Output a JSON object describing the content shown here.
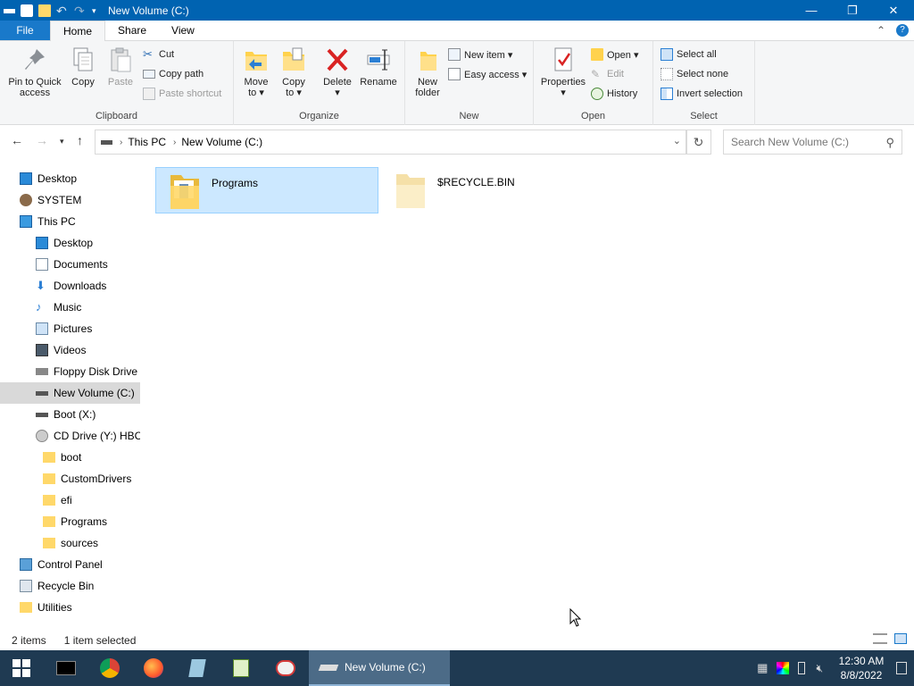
{
  "window": {
    "title": "New Volume (C:)",
    "minimize": "—",
    "maximize": "❐",
    "close": "✕"
  },
  "tabs": [
    "File",
    "Home",
    "Share",
    "View"
  ],
  "ribbon": {
    "clipboard": {
      "label": "Clipboard",
      "pin": "Pin to Quick\naccess",
      "copy": "Copy",
      "paste": "Paste",
      "cut": "Cut",
      "copy_path": "Copy path",
      "paste_shortcut": "Paste shortcut"
    },
    "organize": {
      "label": "Organize",
      "move_to": "Move\nto ▾",
      "copy_to": "Copy\nto ▾",
      "delete": "Delete\n▾",
      "rename": "Rename"
    },
    "new": {
      "label": "New",
      "new_folder": "New\nfolder",
      "new_item": "New item ▾",
      "easy_access": "Easy access ▾"
    },
    "open": {
      "label": "Open",
      "properties": "Properties\n▾",
      "open": "Open ▾",
      "edit": "Edit",
      "history": "History"
    },
    "select": {
      "label": "Select",
      "select_all": "Select all",
      "select_none": "Select none",
      "invert": "Invert selection"
    }
  },
  "address": {
    "segments": [
      "This PC",
      "New Volume (C:)"
    ],
    "search_placeholder": "Search New Volume (C:)"
  },
  "nav_pane": [
    {
      "label": "Desktop",
      "indent": 0,
      "icon": "desktop-icon"
    },
    {
      "label": "SYSTEM",
      "indent": 0,
      "icon": "user-icon"
    },
    {
      "label": "This PC",
      "indent": 0,
      "icon": "pc-icon"
    },
    {
      "label": "Desktop",
      "indent": 1,
      "icon": "desktop-icon"
    },
    {
      "label": "Documents",
      "indent": 1,
      "icon": "documents-icon"
    },
    {
      "label": "Downloads",
      "indent": 1,
      "icon": "downloads-icon"
    },
    {
      "label": "Music",
      "indent": 1,
      "icon": "music-icon"
    },
    {
      "label": "Pictures",
      "indent": 1,
      "icon": "pictures-icon"
    },
    {
      "label": "Videos",
      "indent": 1,
      "icon": "videos-icon"
    },
    {
      "label": "Floppy Disk Drive",
      "indent": 1,
      "icon": "floppy-icon"
    },
    {
      "label": "New Volume (C:)",
      "indent": 1,
      "icon": "drive-icon",
      "selected": true
    },
    {
      "label": "Boot (X:)",
      "indent": 1,
      "icon": "drive-icon"
    },
    {
      "label": "CD Drive (Y:) HBC",
      "indent": 1,
      "icon": "cd-icon"
    },
    {
      "label": "boot",
      "indent": 2,
      "icon": "folder-icon"
    },
    {
      "label": "CustomDrivers",
      "indent": 2,
      "icon": "folder-icon"
    },
    {
      "label": "efi",
      "indent": 2,
      "icon": "folder-icon"
    },
    {
      "label": "Programs",
      "indent": 2,
      "icon": "folder-icon"
    },
    {
      "label": "sources",
      "indent": 2,
      "icon": "folder-icon"
    },
    {
      "label": "Control Panel",
      "indent": 0,
      "icon": "control-panel-icon"
    },
    {
      "label": "Recycle Bin",
      "indent": 0,
      "icon": "recycle-bin-icon"
    },
    {
      "label": "Utilities",
      "indent": 0,
      "icon": "folder-icon"
    }
  ],
  "files": [
    {
      "name": "Programs",
      "selected": true
    },
    {
      "name": "$RECYCLE.BIN",
      "selected": false
    }
  ],
  "status": {
    "count": "2 items",
    "selection": "1 item selected"
  },
  "taskbar": {
    "active_window": "New Volume (C:)",
    "time": "12:30 AM",
    "date": "8/8/2022"
  },
  "colors": {
    "titlebar": "#0063b1",
    "selection": "#cce8ff",
    "taskbar": "#1f3a52"
  }
}
